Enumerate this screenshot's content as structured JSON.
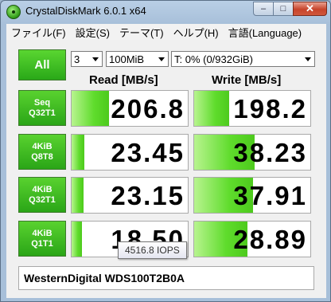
{
  "window": {
    "title": "CrystalDiskMark 6.0.1 x64"
  },
  "title_buttons": {
    "minimize": "–",
    "maximize": "□",
    "close": "✕"
  },
  "menu": [
    "ファイル(F)",
    "設定(S)",
    "テーマ(T)",
    "ヘルプ(H)",
    "言語(Language)"
  ],
  "controls": {
    "all_label": "All",
    "count": "3",
    "size": "100MiB",
    "drive": "T: 0% (0/932GiB)"
  },
  "headers": {
    "read": "Read [MB/s]",
    "write": "Write [MB/s]"
  },
  "rows": [
    {
      "label_top": "Seq",
      "label_bottom": "Q32T1",
      "read": "206.8",
      "write": "198.2",
      "read_fill": 0.32,
      "write_fill": 0.3
    },
    {
      "label_top": "4KiB",
      "label_bottom": "Q8T8",
      "read": "23.45",
      "write": "38.23",
      "read_fill": 0.11,
      "write_fill": 0.52
    },
    {
      "label_top": "4KiB",
      "label_bottom": "Q32T1",
      "read": "23.15",
      "write": "37.91",
      "read_fill": 0.1,
      "write_fill": 0.51
    },
    {
      "label_top": "4KiB",
      "label_bottom": "Q1T1",
      "read": "18.50",
      "write": "28.89",
      "read_fill": 0.09,
      "write_fill": 0.46
    }
  ],
  "status": "WesternDigital WDS100T2B0A",
  "tooltip": "4516.8 IOPS",
  "colors": {
    "bar_green": "#5fdc2c",
    "button_green": "#2aa517"
  }
}
